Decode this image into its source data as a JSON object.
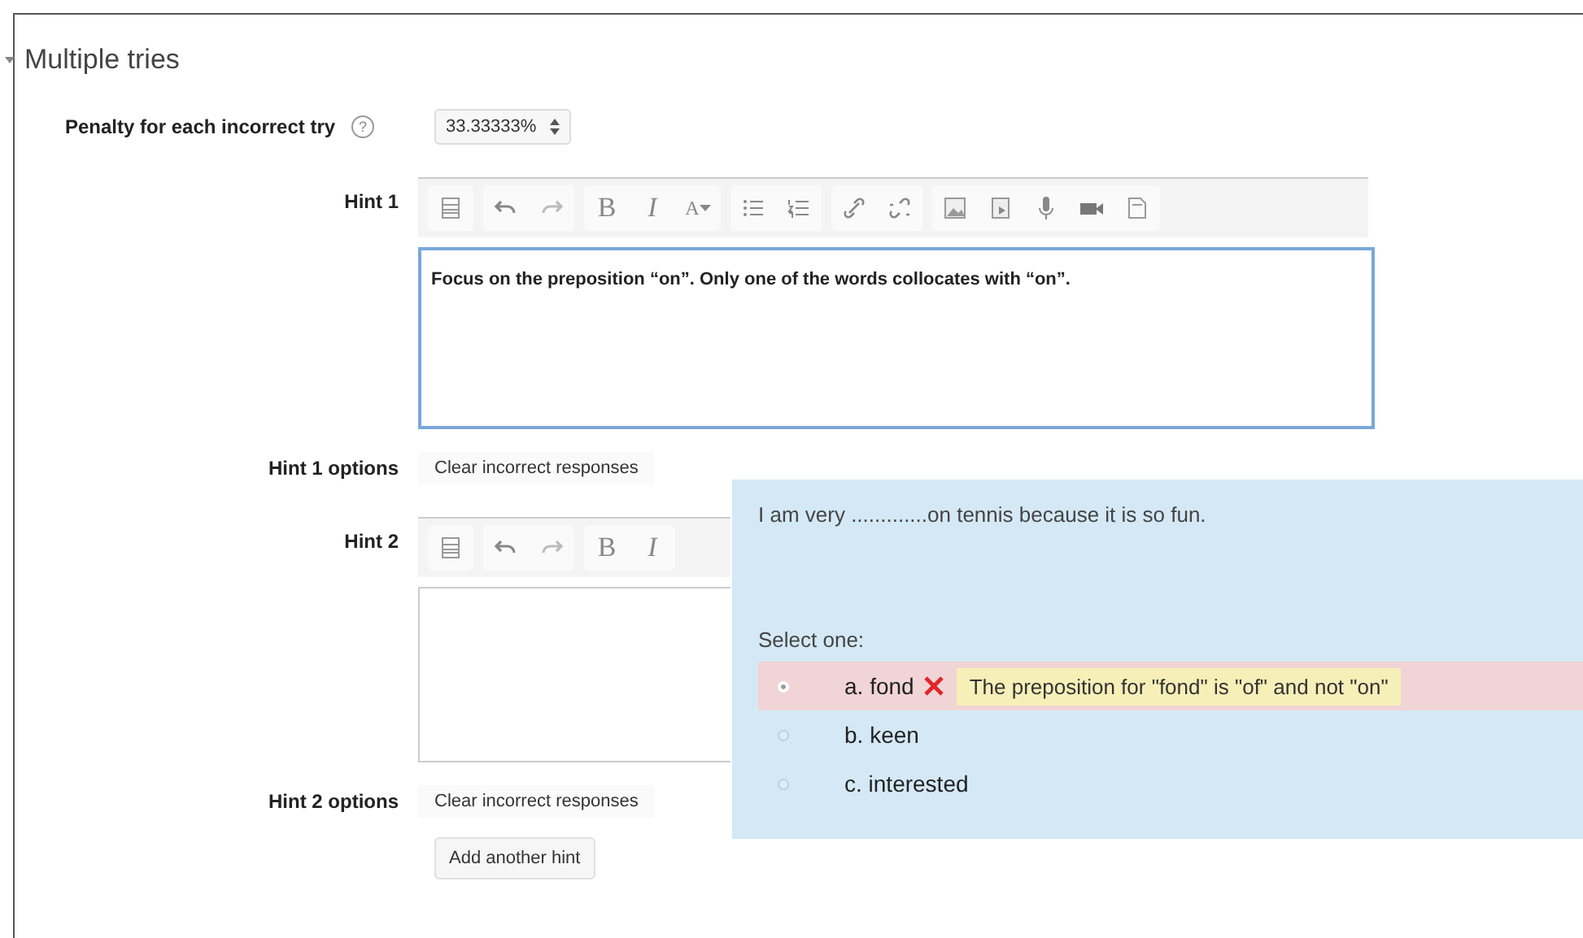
{
  "section": {
    "title": "Multiple tries",
    "expanded": true
  },
  "penalty": {
    "label": "Penalty for each incorrect try",
    "help": "?",
    "value": "33.33333%"
  },
  "hints": [
    {
      "label": "Hint 1",
      "focused": true,
      "text": "Focus on the preposition “on”. Only one of the words collocates with “on”.",
      "toolbar": [
        [
          {
            "kind": "collapse"
          }
        ],
        [
          {
            "kind": "undo"
          },
          {
            "kind": "redo"
          }
        ],
        [
          {
            "kind": "text",
            "label": "B"
          },
          {
            "kind": "text",
            "label": "I"
          },
          {
            "kind": "color",
            "label": "A"
          }
        ],
        [
          {
            "kind": "bullets"
          },
          {
            "kind": "numbers"
          }
        ],
        [
          {
            "kind": "link"
          },
          {
            "kind": "unlink"
          }
        ],
        [
          {
            "kind": "image"
          },
          {
            "kind": "media"
          },
          {
            "kind": "mic"
          },
          {
            "kind": "video"
          },
          {
            "kind": "files"
          }
        ]
      ],
      "options_label": "Hint 1 options",
      "option": "Clear incorrect responses"
    },
    {
      "label": "Hint 2",
      "focused": false,
      "toolbar": [
        [
          {
            "kind": "collapse"
          }
        ],
        [
          {
            "kind": "undo"
          },
          {
            "kind": "redo"
          }
        ],
        [
          {
            "kind": "text",
            "label": "B"
          },
          {
            "kind": "text",
            "label": "I"
          }
        ]
      ],
      "options_label": "Hint 2 options",
      "option": "Clear incorrect responses"
    }
  ],
  "add_button": "Add another hint",
  "preview": {
    "question": "I am very .............on tennis because it is so fun.",
    "prompt": "Select one:",
    "answers": [
      {
        "label": "a. fond",
        "selected": true,
        "incorrect": true,
        "feedback": "The preposition for \"fond\" is \"of\" and not \"on\""
      },
      {
        "label": "b. keen",
        "selected": false,
        "incorrect": false
      },
      {
        "label": "c. interested",
        "selected": false,
        "incorrect": false
      }
    ]
  }
}
